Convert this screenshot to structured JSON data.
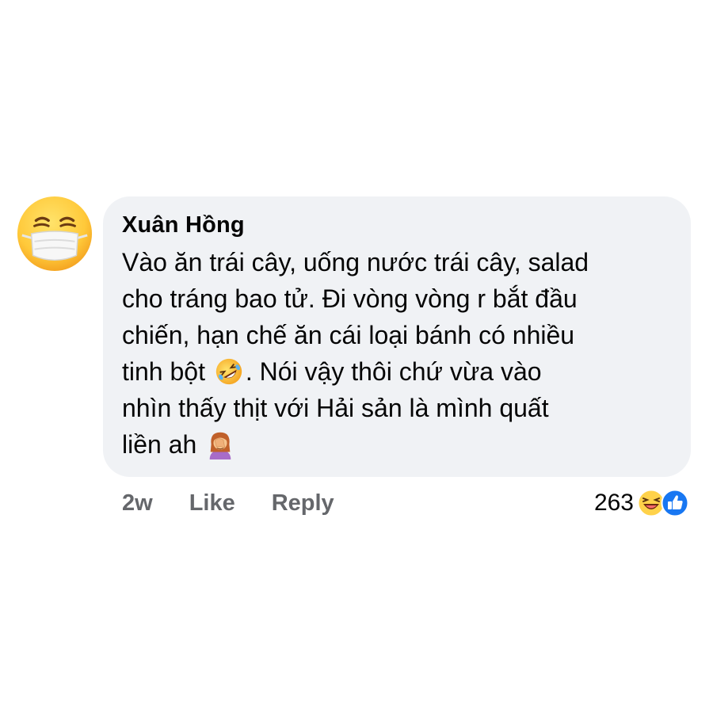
{
  "comment": {
    "author": "Xuân Hồng",
    "text_lines": [
      "Vào ăn trái cây, uống nước trái cây, salad",
      "cho tráng bao tử. Đi vòng vòng r bắt đầu",
      "chiến, hạn chế ăn cái loại bánh có nhiều",
      "tinh bột",
      ". Nói vậy thôi chứ vừa vào",
      "nhìn thấy thịt với Hải sản là mình quất",
      "liền ah"
    ],
    "avatar_icon": "face-with-medical-mask-icon",
    "inline_emojis": [
      "rolling-on-floor-laughing-icon",
      "woman-facepalming-icon"
    ]
  },
  "actions": {
    "time": "2w",
    "like_label": "Like",
    "reply_label": "Reply"
  },
  "reactions": {
    "count": "263",
    "icons": [
      "haha-icon",
      "like-icon"
    ]
  },
  "colors": {
    "bubble": "#f0f2f5",
    "text": "#050505",
    "meta": "#65676b",
    "like_blue": "#1877f2"
  }
}
